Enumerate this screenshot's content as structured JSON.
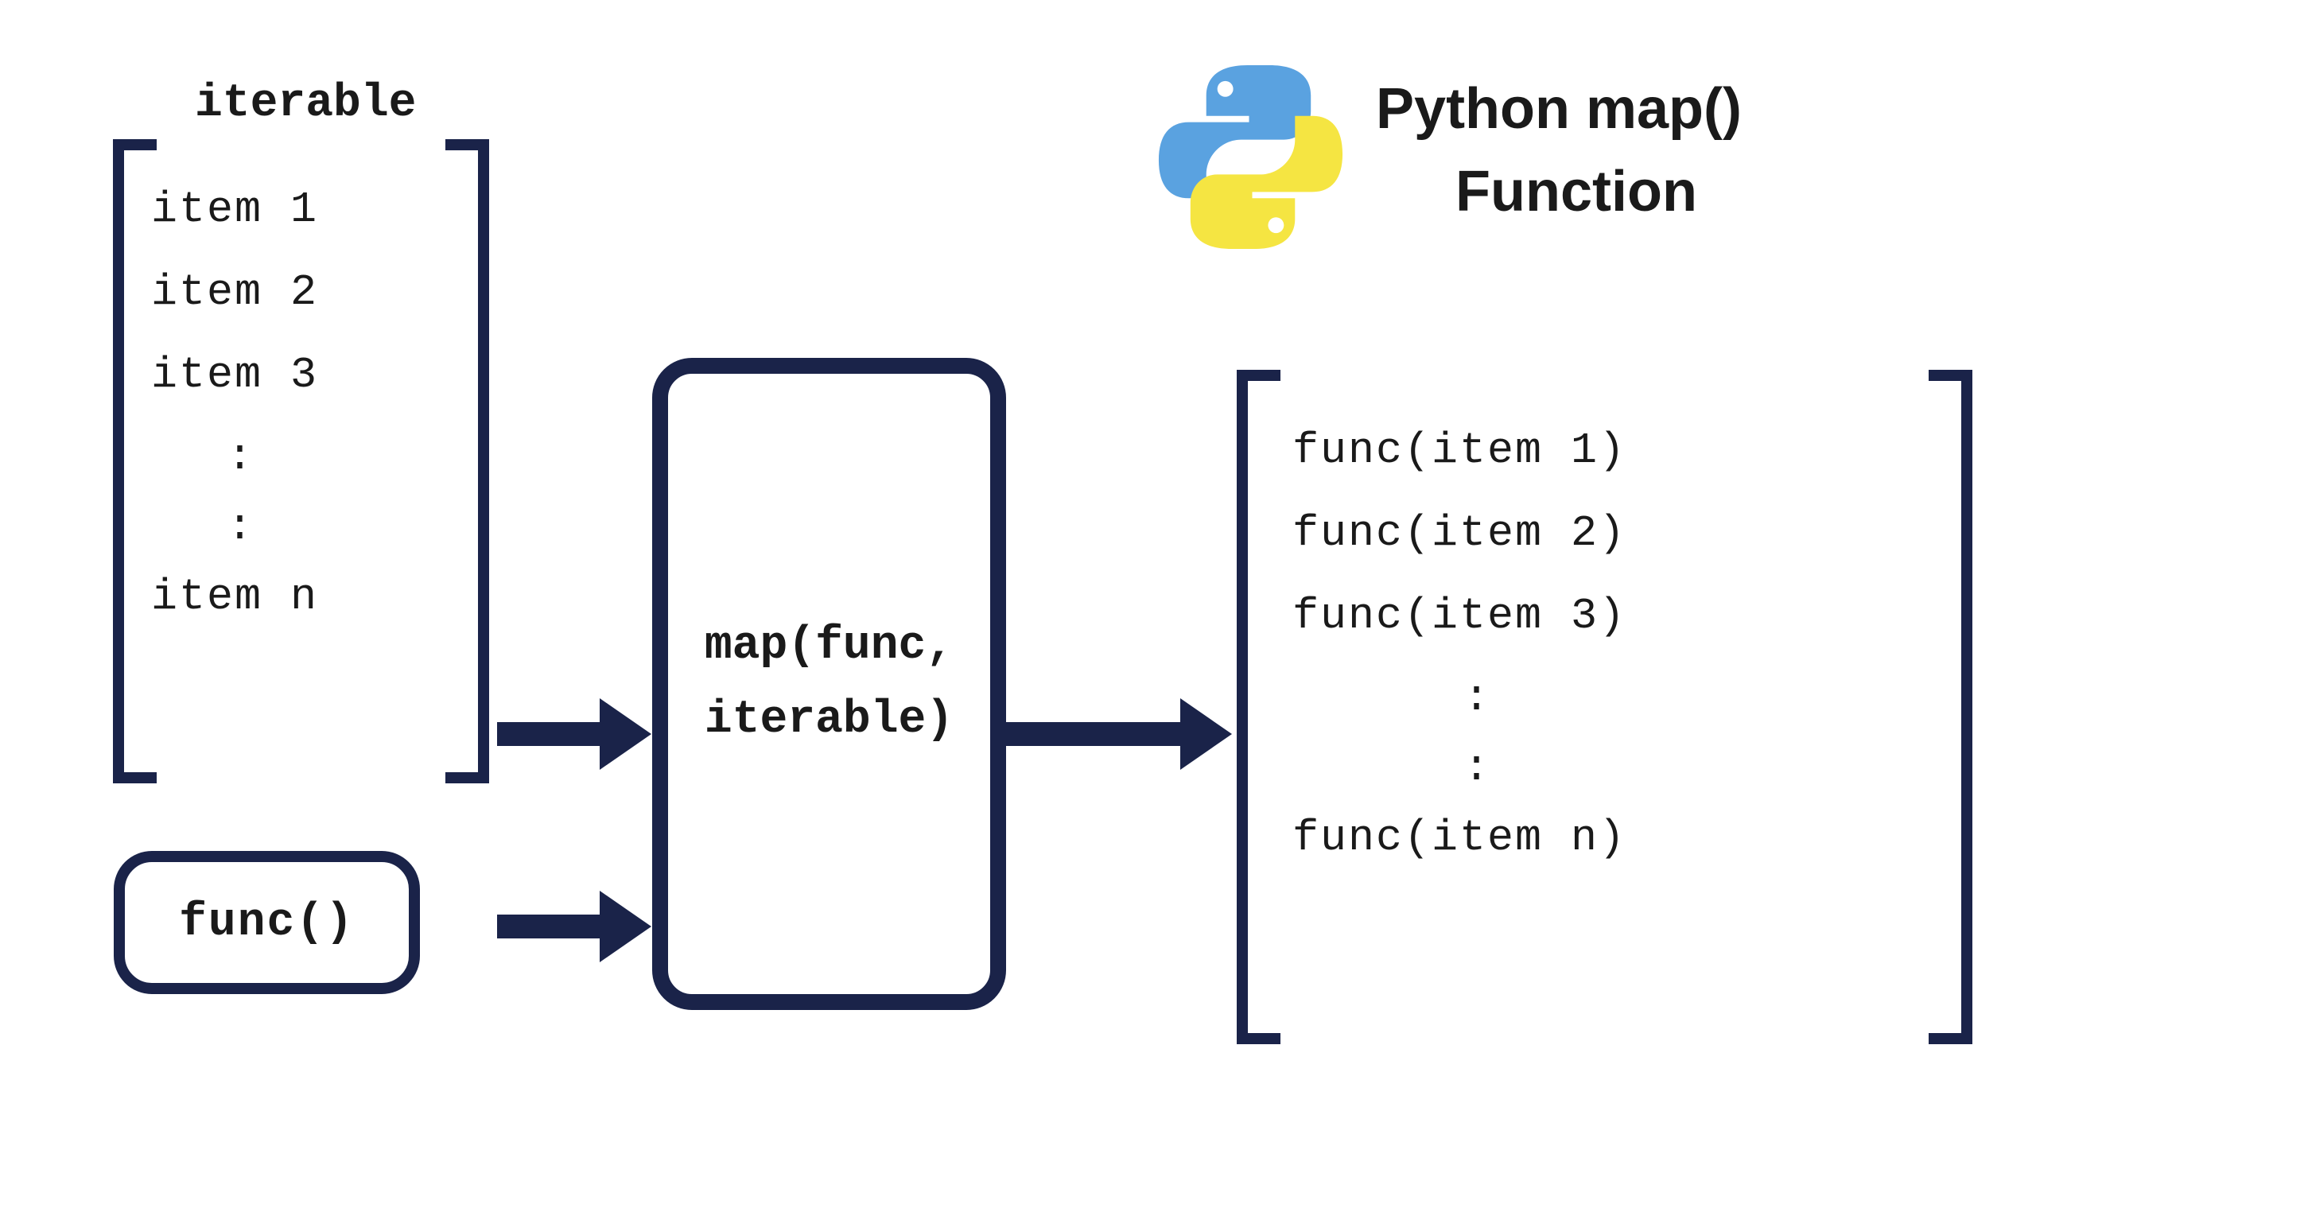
{
  "title": {
    "line1": "Python map()",
    "line2": "Function"
  },
  "logo": {
    "name": "python-logo",
    "colors": {
      "blue": "#5aa2e0",
      "yellow": "#f5e542"
    }
  },
  "iterable": {
    "label": "iterable",
    "items": [
      "item 1",
      "item 2",
      "item 3"
    ],
    "ellipsis": ":",
    "last_item": "item n"
  },
  "func_box": {
    "label": "func()"
  },
  "map_box": {
    "line1": "map(func,",
    "line2": "iterable)"
  },
  "output": {
    "items": [
      "func(item 1)",
      "func(item 2)",
      "func(item 3)"
    ],
    "ellipsis": ":",
    "last_item": "func(item n)"
  },
  "colors": {
    "stroke": "#1a2349",
    "text": "#1a1a1a"
  }
}
